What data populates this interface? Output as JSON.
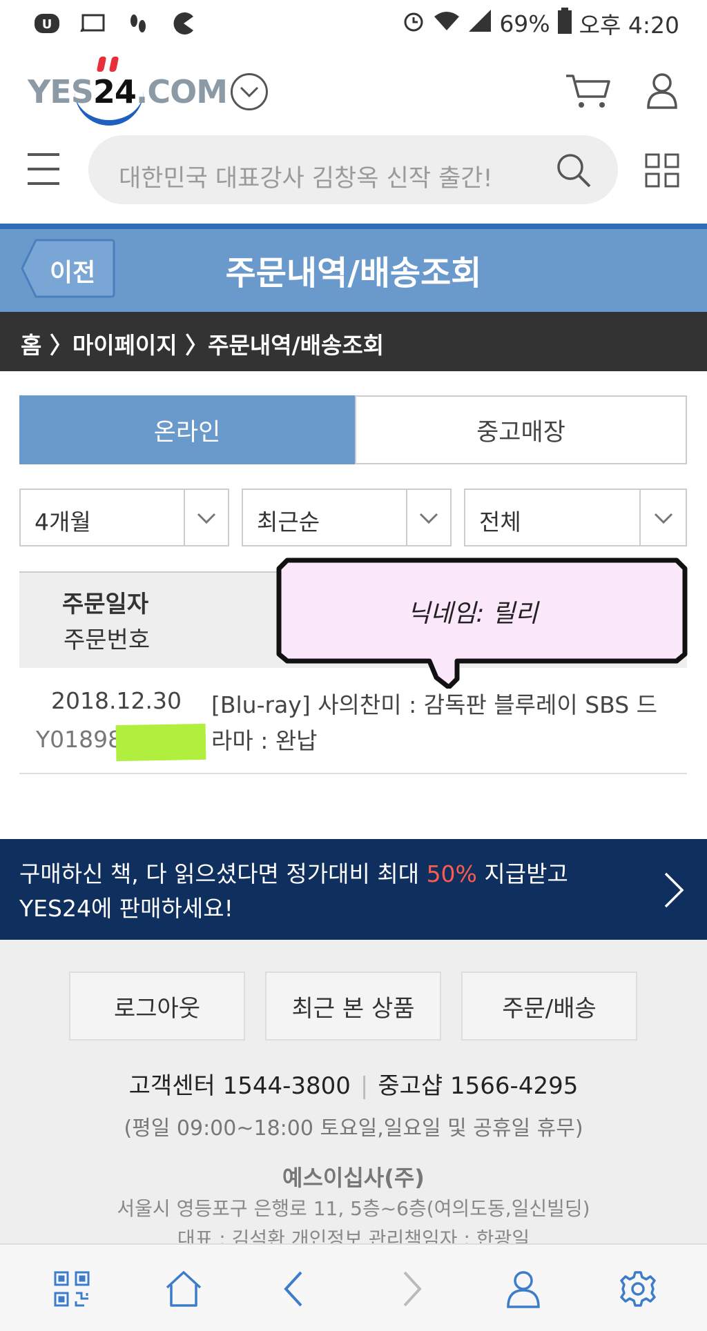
{
  "statusbar": {
    "battery": "69%",
    "time": "오후 4:20",
    "icons": [
      "uplus-icon",
      "cast-icon",
      "walk-icon",
      "pacman-icon",
      "alarm-icon",
      "wifi-icon",
      "signal-icon",
      "battery-icon"
    ]
  },
  "header": {
    "logo_prefix": "YES",
    "logo_number": "24",
    "logo_suffix": ".COM",
    "search_placeholder": "대한민국 대표강사 김창옥 신작 출간!"
  },
  "titlebar": {
    "back_label": "이전",
    "title": "주문내역/배송조회"
  },
  "breadcrumb": {
    "text": "홈 〉마이페이지 〉주문내역/배송조회"
  },
  "tabs": [
    {
      "label": "온라인",
      "active": true
    },
    {
      "label": "중고매장",
      "active": false
    }
  ],
  "filters": {
    "period": "4개월",
    "sort": "최근순",
    "status": "전체"
  },
  "table": {
    "header_date": "주문일자",
    "header_number": "주문번호",
    "rows": [
      {
        "date": "2018.12.30",
        "order_no": "Y01898",
        "title": "[Blu-ray] 사의찬미 : 감독판 블루레이 SBS 드라마 : 완납"
      }
    ]
  },
  "sticker": {
    "text": "닉네임: 릴리"
  },
  "banner": {
    "line1_prefix": "구매하신 책, 다 읽으셨다면 정가대비 최대 ",
    "line1_percent": "50%",
    "line1_suffix": " 지급받고",
    "line2": "YES24에 판매하세요!"
  },
  "footer": {
    "buttons": [
      "로그아웃",
      "최근 본 상품",
      "주문/배송"
    ],
    "cs_label": "고객센터 1544-3800",
    "used_label": "중고샵 1566-4295",
    "hours": "(평일 09:00~18:00 토요일,일요일 및 공휴일 휴무)",
    "company": "예스이십사(주)",
    "address": "서울시 영등포구 은행로 11, 5층~6층(여의도동,일신빌딩)",
    "representative": "대표 : 김석환   개인정보 관리책임자 : 한광일"
  },
  "bottomnav": [
    "qr-code-icon",
    "home-icon",
    "back-arrow-icon",
    "forward-arrow-icon",
    "user-icon",
    "settings-gear-icon"
  ],
  "colors": {
    "primary_blue": "#6a99cc",
    "dark_navy": "#0f2f5f",
    "highlight_red": "#ff5a4f",
    "highlighter_green": "#b0ef3d"
  }
}
